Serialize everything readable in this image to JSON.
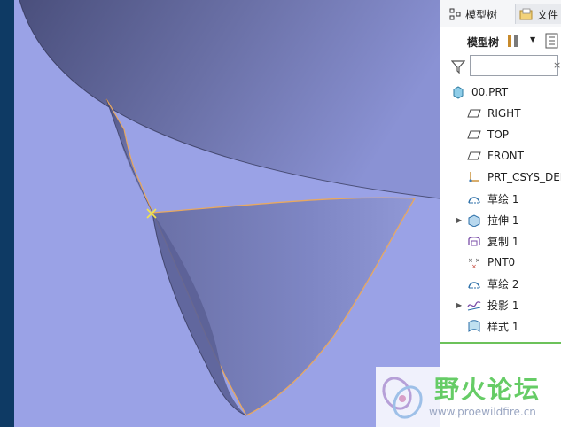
{
  "panel": {
    "tab_model_tree": "模型树",
    "tab_second": "文件",
    "toolbar_label": "模型树",
    "filter_placeholder": "",
    "filter_clear": "×"
  },
  "tree": [
    {
      "label": "00.PRT",
      "icon": "part-icon"
    },
    {
      "label": "RIGHT",
      "icon": "datum-plane-icon"
    },
    {
      "label": "TOP",
      "icon": "datum-plane-icon"
    },
    {
      "label": "FRONT",
      "icon": "datum-plane-icon"
    },
    {
      "label": "PRT_CSYS_DEF",
      "icon": "csys-icon"
    },
    {
      "label": "草绘 1",
      "icon": "sketch-icon"
    },
    {
      "label": "拉伸 1",
      "icon": "extrude-icon",
      "expandable": true
    },
    {
      "label": "复制 1",
      "icon": "copy-icon"
    },
    {
      "label": "PNT0",
      "icon": "datum-point-icon"
    },
    {
      "label": "草绘 2",
      "icon": "sketch-icon"
    },
    {
      "label": "投影 1",
      "icon": "projection-icon",
      "expandable": true
    },
    {
      "label": "样式 1",
      "icon": "style-icon"
    }
  ],
  "watermark": {
    "title": "野火论坛",
    "url": "www.proewildfire.cn"
  },
  "colors": {
    "background": "#9aa2e6",
    "surface_dark": "#5d6398",
    "edge": "#e8a860",
    "accent_green": "#6cc25a"
  }
}
